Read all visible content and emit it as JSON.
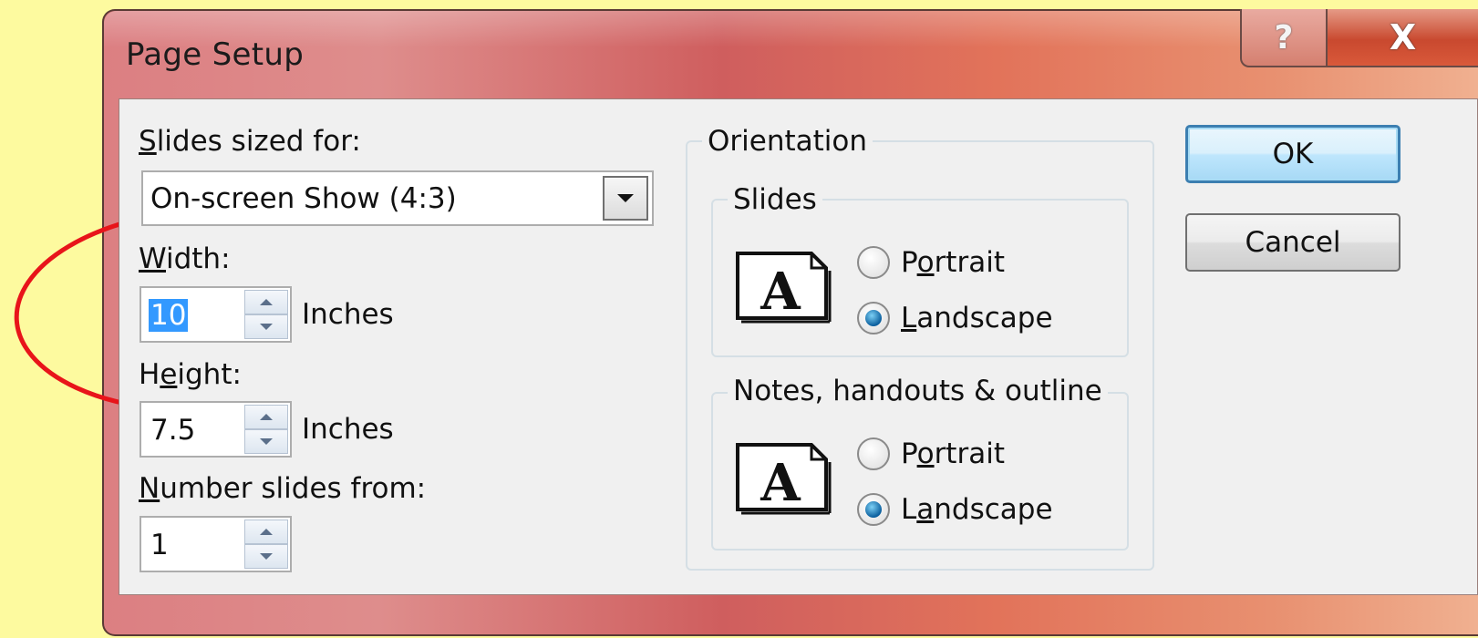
{
  "window": {
    "title": "Page Setup",
    "help_label": "?",
    "close_label": "X"
  },
  "slides_sized_for": {
    "label_u": "S",
    "label_rest": "lides sized for:",
    "value": "On-screen Show (4:3)"
  },
  "width": {
    "label_u": "W",
    "label_rest": "idth:",
    "value": "10",
    "unit": "Inches"
  },
  "height": {
    "label_a": "H",
    "label_u": "e",
    "label_rest": "ight:",
    "value": "7.5",
    "unit": "Inches"
  },
  "number_from": {
    "label_u": "N",
    "label_rest": "umber slides from:",
    "value": "1"
  },
  "orientation": {
    "title": "Orientation",
    "slides": {
      "title": "Slides",
      "icon_letter": "A",
      "portrait": {
        "a": "P",
        "u": "o",
        "rest": "rtrait"
      },
      "landscape": {
        "u": "L",
        "rest": "andscape"
      },
      "selected": "landscape"
    },
    "notes": {
      "title": "Notes, handouts & outline",
      "icon_letter": "A",
      "portrait": {
        "a": "P",
        "u": "o",
        "rest": "rtrait"
      },
      "landscape": {
        "a": "L",
        "u": "a",
        "rest": "ndscape"
      },
      "selected": "landscape"
    }
  },
  "buttons": {
    "ok": "OK",
    "cancel": "Cancel"
  },
  "colors": {
    "background": "#fdfa9f",
    "annotation": "#e8141a",
    "selection": "#3399ff"
  }
}
